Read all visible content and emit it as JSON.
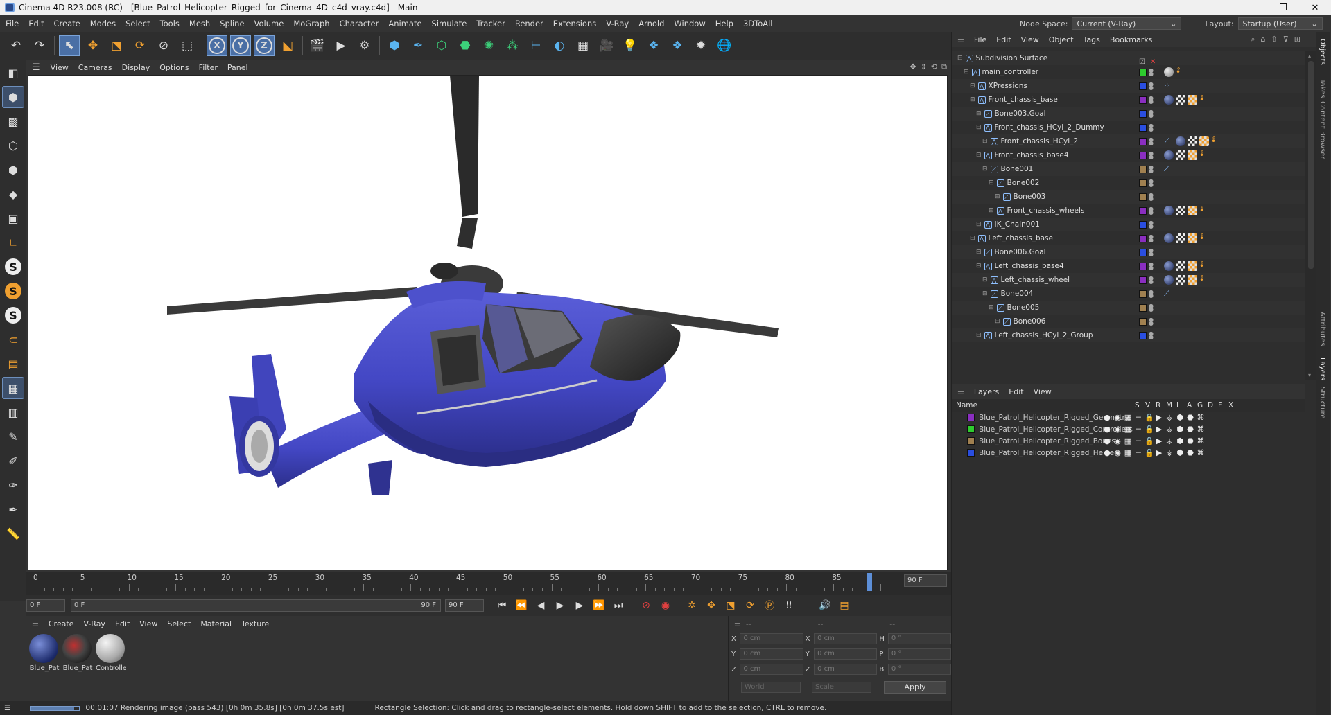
{
  "window": {
    "title": "Cinema 4D R23.008 (RC) - [Blue_Patrol_Helicopter_Rigged_for_Cinema_4D_c4d_vray.c4d] - Main",
    "min": "—",
    "max": "❐",
    "close": "✕"
  },
  "menubar": {
    "items": [
      "File",
      "Edit",
      "Create",
      "Modes",
      "Select",
      "Tools",
      "Mesh",
      "Spline",
      "Volume",
      "MoGraph",
      "Character",
      "Animate",
      "Simulate",
      "Tracker",
      "Render",
      "Extensions",
      "V-Ray",
      "Arnold",
      "Window",
      "Help",
      "3DToAll"
    ],
    "node_space_label": "Node Space:",
    "node_space_value": "Current (V-Ray)",
    "layout_label": "Layout:",
    "layout_value": "Startup (User)"
  },
  "viewport": {
    "menu": [
      "View",
      "Cameras",
      "Display",
      "Options",
      "Filter",
      "Panel"
    ]
  },
  "timeline": {
    "ticks": [
      "0",
      "5",
      "10",
      "15",
      "20",
      "25",
      "30",
      "35",
      "40",
      "45",
      "50",
      "55",
      "60",
      "65",
      "70",
      "75",
      "80",
      "85"
    ],
    "end_frame": "90 F",
    "current": "0 F",
    "range_start": "0 F",
    "range_end": "90 F",
    "max_field": "90 F",
    "playhead": 0.0
  },
  "materials": {
    "menu": [
      "Create",
      "V-Ray",
      "Edit",
      "View",
      "Select",
      "Material",
      "Texture"
    ],
    "items": [
      {
        "label": "Blue_Pat"
      },
      {
        "label": "Blue_Pat"
      },
      {
        "label": "Controlle"
      }
    ]
  },
  "coords": {
    "header": [
      "--",
      "--",
      "--"
    ],
    "rows": [
      {
        "a": "X",
        "v1": "0 cm",
        "b": "X",
        "v2": "0 cm",
        "c": "H",
        "v3": "0 °"
      },
      {
        "a": "Y",
        "v1": "0 cm",
        "b": "Y",
        "v2": "0 cm",
        "c": "P",
        "v3": "0 °"
      },
      {
        "a": "Z",
        "v1": "0 cm",
        "b": "Z",
        "v2": "0 cm",
        "c": "B",
        "v3": "0 °"
      }
    ],
    "mode1": "World",
    "mode2": "Scale",
    "apply": "Apply"
  },
  "status": {
    "render": "00:01:07 Rendering image (pass 543) [0h  0m 35.8s] [0h  0m 37.5s est]",
    "hint": "Rectangle Selection: Click and drag to rectangle-select elements. Hold down SHIFT to add to the selection, CTRL to remove.",
    "progress": 0.9
  },
  "objects": {
    "menu": [
      "File",
      "Edit",
      "View",
      "Object",
      "Tags",
      "Bookmarks"
    ],
    "rows": [
      {
        "name": "Subdivision Surface",
        "indent": 0,
        "color": "#777777",
        "tags": "check"
      },
      {
        "name": "main_controller",
        "indent": 1,
        "color": "#2ecc2e",
        "tags": "ctrl"
      },
      {
        "name": "XPressions",
        "indent": 2,
        "color": "#2a4ee0",
        "tags": "xp"
      },
      {
        "name": "Front_chassis_base",
        "indent": 2,
        "color": "#8a2ec0",
        "tags": "full"
      },
      {
        "name": "Bone003.Goal",
        "indent": 3,
        "color": "#2a4ee0",
        "tags": ""
      },
      {
        "name": "Front_chassis_HCyl_2_Dummy",
        "indent": 3,
        "color": "#2a4ee0",
        "tags": ""
      },
      {
        "name": "Front_chassis_HCyl_2",
        "indent": 4,
        "color": "#8a2ec0",
        "tags": "full2"
      },
      {
        "name": "Front_chassis_base4",
        "indent": 3,
        "color": "#8a2ec0",
        "tags": "full"
      },
      {
        "name": "Bone001",
        "indent": 4,
        "color": "#a08050",
        "tags": "bone"
      },
      {
        "name": "Bone002",
        "indent": 5,
        "color": "#a08050",
        "tags": ""
      },
      {
        "name": "Bone003",
        "indent": 6,
        "color": "#a08050",
        "tags": ""
      },
      {
        "name": "Front_chassis_wheels",
        "indent": 5,
        "color": "#8a2ec0",
        "tags": "full"
      },
      {
        "name": "IK_Chain001",
        "indent": 3,
        "color": "#2a4ee0",
        "tags": ""
      },
      {
        "name": "Left_chassis_base",
        "indent": 2,
        "color": "#8a2ec0",
        "tags": "full"
      },
      {
        "name": "Bone006.Goal",
        "indent": 3,
        "color": "#2a4ee0",
        "tags": ""
      },
      {
        "name": "Left_chassis_base4",
        "indent": 3,
        "color": "#8a2ec0",
        "tags": "full"
      },
      {
        "name": "Left_chassis_wheel",
        "indent": 4,
        "color": "#8a2ec0",
        "tags": "full"
      },
      {
        "name": "Bone004",
        "indent": 4,
        "color": "#a08050",
        "tags": "bone"
      },
      {
        "name": "Bone005",
        "indent": 5,
        "color": "#a08050",
        "tags": ""
      },
      {
        "name": "Bone006",
        "indent": 6,
        "color": "#a08050",
        "tags": ""
      },
      {
        "name": "Left_chassis_HCyl_2_Group",
        "indent": 3,
        "color": "#2a4ee0",
        "tags": ""
      }
    ]
  },
  "layers": {
    "menu": [
      "Layers",
      "Edit",
      "View"
    ],
    "columns": {
      "name": "Name",
      "flags": [
        "S",
        "V",
        "R",
        "M",
        "L",
        "A",
        "G",
        "D",
        "E",
        "X"
      ]
    },
    "rows": [
      {
        "name": "Blue_Patrol_Helicopter_Rigged_Geometry",
        "color": "#8a2ec0"
      },
      {
        "name": "Blue_Patrol_Helicopter_Rigged_Controllers",
        "color": "#2ecc2e"
      },
      {
        "name": "Blue_Patrol_Helicopter_Rigged_Bones",
        "color": "#a08050"
      },
      {
        "name": "Blue_Patrol_Helicopter_Rigged_Helpers",
        "color": "#2a4ee0"
      }
    ]
  },
  "sidetabs": [
    "Objects",
    "Takes",
    "Content Browser",
    "Attributes",
    "Layers",
    "Structure"
  ]
}
